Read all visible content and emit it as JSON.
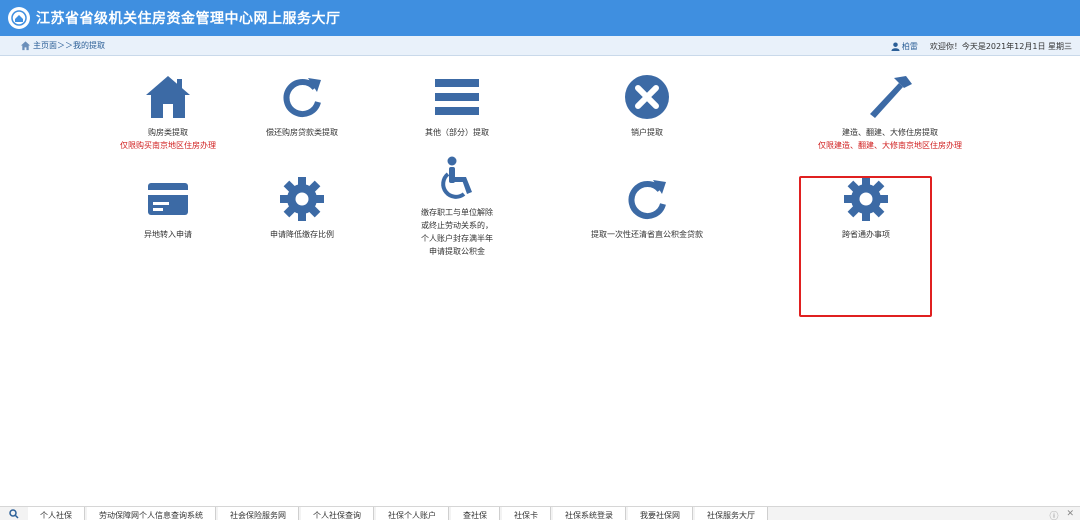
{
  "header": {
    "title": "江苏省省级机关住房资金管理中心网上服务大厅",
    "logo_icon": "emblem-icon"
  },
  "breadcrumb": {
    "home_icon": "home-icon",
    "text": "主页面＞＞我的提取"
  },
  "userbar": {
    "user_icon": "user-icon",
    "user_name": "柏雷",
    "greeting": "欢迎你！今天是2021年12月1日 星期三"
  },
  "colors": {
    "titlebar": "#3f8fe0",
    "icon": "#3c6aa5",
    "note": "#d01f1f",
    "highlight": "#e02020"
  },
  "tiles": [
    {
      "icon": "house-icon",
      "label": "购房类提取",
      "note": "仅限购买南京地区住房办理"
    },
    {
      "icon": "refresh-icon",
      "label": "偿还购房贷款类提取",
      "note": ""
    },
    {
      "icon": "menu-bars-icon",
      "label": "其他（部分）提取",
      "note": ""
    },
    {
      "icon": "close-circle-icon",
      "label": "销户提取",
      "note": ""
    },
    {
      "icon": "hammer-icon",
      "label": "建造、翻建、大修住房提取",
      "note": "仅限建造、翻建、大修南京地区住房办理"
    },
    {
      "icon": "card-icon",
      "label": "异地转入申请",
      "note": ""
    },
    {
      "icon": "gear-icon",
      "label": "申请降低缴存比例",
      "note": ""
    },
    {
      "icon": "wheelchair-icon",
      "label_lines": [
        "缴存职工与单位解除",
        "或终止劳动关系的，",
        "个人账户封存满半年",
        "申请提取公积金"
      ]
    },
    {
      "icon": "refresh-icon",
      "label": "提取一次性还清省直公积金贷款",
      "note": ""
    },
    {
      "icon": "gear-icon",
      "label": "跨省通办事项",
      "note": ""
    }
  ],
  "taskbar": {
    "tabs": [
      "个人社保",
      "劳动保障网个人信息查询系统",
      "社会保险服务网",
      "个人社保查询",
      "社保个人账户",
      "查社保",
      "社保卡",
      "社保系统登录",
      "我要社保网",
      "社保服务大厅"
    ],
    "end_icons": [
      "info-icon",
      "close-icon"
    ]
  }
}
